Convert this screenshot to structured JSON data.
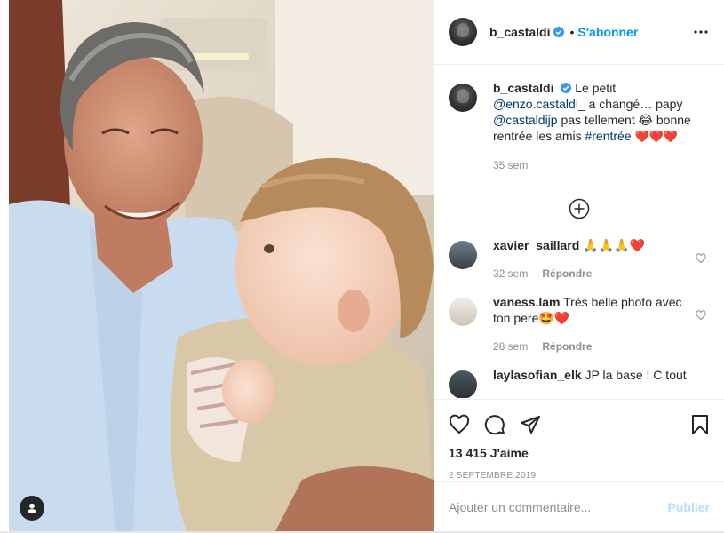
{
  "post": {
    "username": "b_castaldi",
    "follow_label": "S'abonner",
    "dot": "•"
  },
  "caption": {
    "username": "b_castaldi",
    "text_1": "Le petit ",
    "mention_1": "@enzo.castaldi_",
    "text_2": " a changé… papy ",
    "mention_2": "@castaldijp",
    "text_3": " pas tellement ",
    "emoji_laugh": "😂",
    "text_4": " bonne rentrée les amis ",
    "hashtag": "#rentrée",
    "hearts": "❤️❤️❤️",
    "time": "35 sem"
  },
  "comments": [
    {
      "username": "xavier_saillard",
      "text": "🙏🙏🙏❤️",
      "time": "32 sem",
      "reply": "Répondre"
    },
    {
      "username": "vaness.lam",
      "text": "Très belle photo avec ton pere🤩❤️",
      "time": "28 sem",
      "reply": "Répondre"
    },
    {
      "username": "laylasofian_elk",
      "text": "JP la base ! C tout",
      "time": "",
      "reply": ""
    }
  ],
  "stats": {
    "likes": "13 415 J'aime",
    "date": "2 SEPTEMBRE 2019"
  },
  "composer": {
    "placeholder": "Ajouter un commentaire...",
    "publish_label": "Publier"
  },
  "colors": {
    "accent": "#0095f6",
    "link": "#00376b",
    "muted": "#8e8e8e",
    "publish_disabled": "#b2dffc"
  },
  "icons": {
    "like": "heart-outline-icon",
    "comment": "comment-bubble-icon",
    "share": "paper-plane-icon",
    "save": "bookmark-icon",
    "more": "more-horizontal-icon",
    "load_more": "plus-circle-icon",
    "tag": "user-tag-icon",
    "verified": "verified-badge-icon"
  }
}
